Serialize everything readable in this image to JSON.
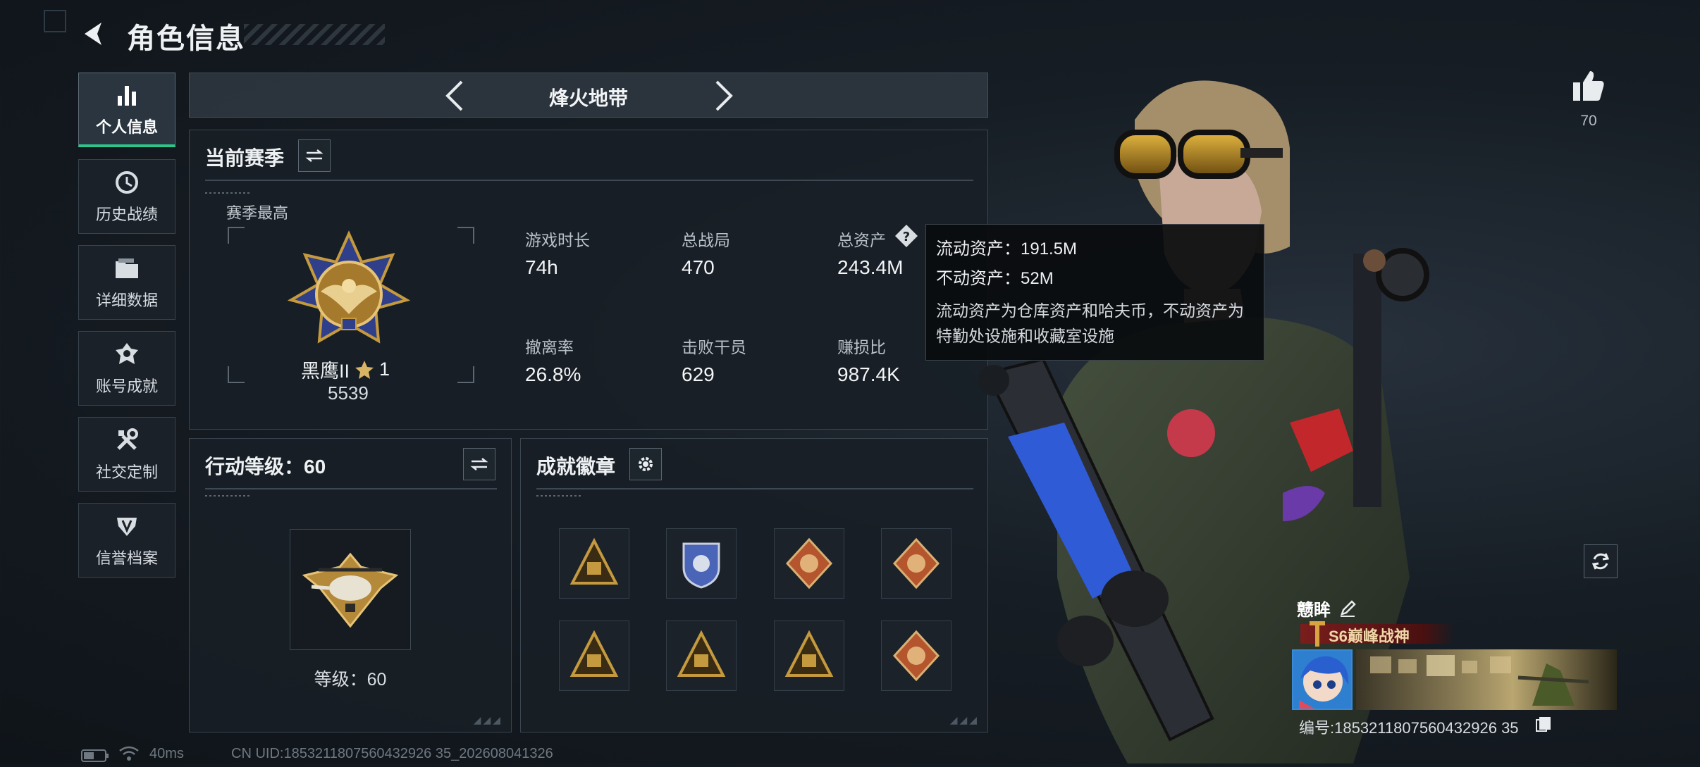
{
  "header": {
    "title": "角色信息"
  },
  "nav": {
    "items": [
      {
        "label": "个人信息",
        "icon": "bar-chart-icon",
        "active": true
      },
      {
        "label": "历史战绩",
        "icon": "history-clock-icon"
      },
      {
        "label": "详细数据",
        "icon": "folder-icon"
      },
      {
        "label": "账号成就",
        "icon": "achievement-icon"
      },
      {
        "label": "社交定制",
        "icon": "tools-icon"
      },
      {
        "label": "信誉档案",
        "icon": "credit-shield-icon"
      }
    ]
  },
  "mode": {
    "name": "烽火地带"
  },
  "season": {
    "title": "当前赛季",
    "best_label": "赛季最高",
    "rank_name": "黑鹰II",
    "rank_stars": "1",
    "rank_score": "5539",
    "stats": [
      {
        "label": "游戏时长",
        "value": "74h"
      },
      {
        "label": "总战局",
        "value": "470"
      },
      {
        "label": "总资产",
        "value": "243.4M"
      },
      {
        "label": "撤离率",
        "value": "26.8%"
      },
      {
        "label": "击败干员",
        "value": "629"
      },
      {
        "label": "赚损比",
        "value": "987.4K"
      }
    ]
  },
  "tooltip": {
    "line1": "流动资产：191.5M",
    "line2": "不动资产：52M",
    "desc": "流动资产为仓库资产和哈夫币，不动资产为特勤处设施和收藏室设施"
  },
  "action_level": {
    "title": "行动等级：60",
    "level_text": "等级：60"
  },
  "badges": {
    "title": "成就徽章",
    "items": [
      {
        "name": "supply-badge",
        "color": "#c59a3e"
      },
      {
        "name": "shield-badge",
        "color": "#4a64b8"
      },
      {
        "name": "dragon-badge-1",
        "color": "#b5552e"
      },
      {
        "name": "dragon-badge-2",
        "color": "#b5552e"
      },
      {
        "name": "helmet-badge",
        "color": "#c59a3e"
      },
      {
        "name": "skull-badge",
        "color": "#c59a3e"
      },
      {
        "name": "castle-badge",
        "color": "#c59a3e"
      },
      {
        "name": "wolf-badge",
        "color": "#b5552e"
      }
    ]
  },
  "profile": {
    "likes": "70",
    "name": "戆眸",
    "title_tag": "S6巅峰战神",
    "id": "编号:1853211807560432926 35"
  },
  "footer": {
    "ping": "40ms",
    "uid": "CN UID:1853211807560432926 35_202608041326"
  },
  "colors": {
    "accent": "#2ec58a",
    "gold": "#c59a3e",
    "panel": "#181f26"
  }
}
